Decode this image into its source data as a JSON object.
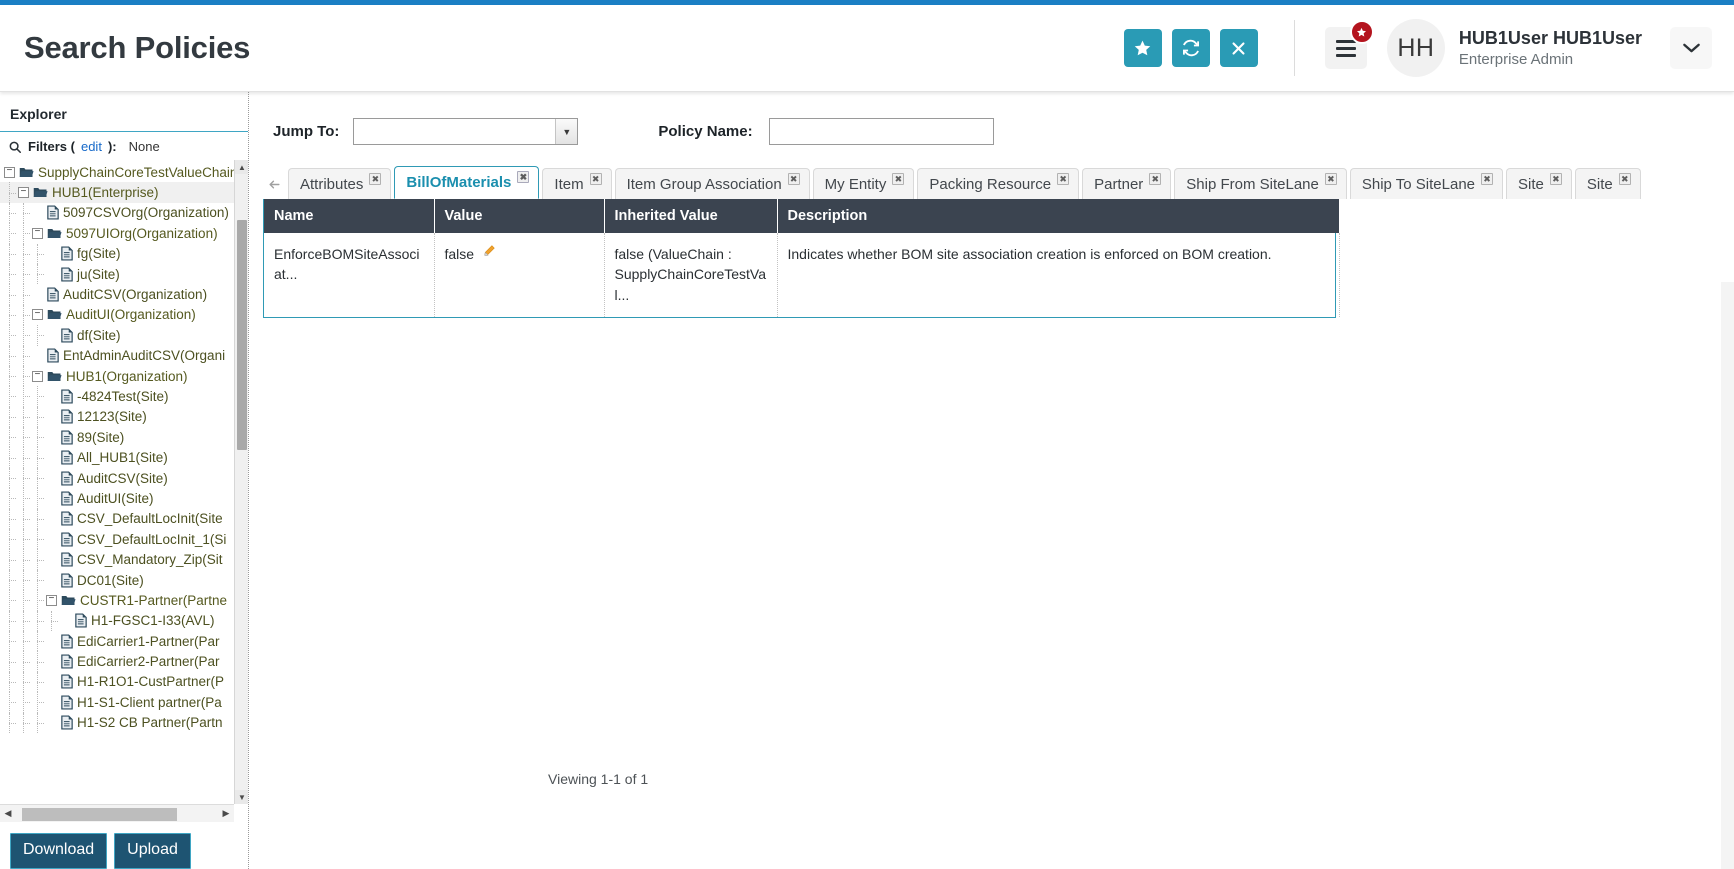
{
  "header": {
    "title": "Search Policies",
    "actions": [
      {
        "name": "favorite",
        "icon": "star-icon",
        "label": "★"
      },
      {
        "name": "refresh",
        "icon": "refresh-icon",
        "label": "⟳"
      },
      {
        "name": "close",
        "icon": "close-icon",
        "label": "✕"
      }
    ],
    "menu_badge": "★",
    "avatar_initials": "HH",
    "user_name": "HUB1User HUB1User",
    "user_role": "Enterprise Admin",
    "caret": "⌄"
  },
  "sidebar": {
    "title": "Explorer",
    "filters_label": "Filters (",
    "filters_edit": "edit",
    "filters_label_end": "):",
    "filters_value": "None",
    "footer_buttons": [
      {
        "label": "Download",
        "name": "download-button"
      },
      {
        "label": "Upload",
        "name": "upload-button"
      }
    ],
    "tree": [
      {
        "label": "SupplyChainCoreTestValueChain(",
        "depth": 0,
        "type": "folder",
        "toggle": "minus",
        "selected": false
      },
      {
        "label": "HUB1(Enterprise)",
        "depth": 1,
        "type": "folder",
        "toggle": "minus",
        "selected": true
      },
      {
        "label": "5097CSVOrg(Organization)",
        "depth": 2,
        "type": "file",
        "toggle": "none",
        "selected": false
      },
      {
        "label": "5097UIOrg(Organization)",
        "depth": 2,
        "type": "folder",
        "toggle": "minus",
        "selected": false
      },
      {
        "label": "fg(Site)",
        "depth": 3,
        "type": "file",
        "toggle": "none",
        "selected": false
      },
      {
        "label": "ju(Site)",
        "depth": 3,
        "type": "file",
        "toggle": "none",
        "selected": false
      },
      {
        "label": "AuditCSV(Organization)",
        "depth": 2,
        "type": "file",
        "toggle": "none",
        "selected": false
      },
      {
        "label": "AuditUI(Organization)",
        "depth": 2,
        "type": "folder",
        "toggle": "minus",
        "selected": false
      },
      {
        "label": "df(Site)",
        "depth": 3,
        "type": "file",
        "toggle": "none",
        "selected": false
      },
      {
        "label": "EntAdminAuditCSV(Organi",
        "depth": 2,
        "type": "file",
        "toggle": "none",
        "selected": false
      },
      {
        "label": "HUB1(Organization)",
        "depth": 2,
        "type": "folder",
        "toggle": "minus",
        "selected": false
      },
      {
        "label": "-4824Test(Site)",
        "depth": 3,
        "type": "file",
        "toggle": "none",
        "selected": false
      },
      {
        "label": "12123(Site)",
        "depth": 3,
        "type": "file",
        "toggle": "none",
        "selected": false
      },
      {
        "label": "89(Site)",
        "depth": 3,
        "type": "file",
        "toggle": "none",
        "selected": false
      },
      {
        "label": "All_HUB1(Site)",
        "depth": 3,
        "type": "file",
        "toggle": "none",
        "selected": false
      },
      {
        "label": "AuditCSV(Site)",
        "depth": 3,
        "type": "file",
        "toggle": "none",
        "selected": false
      },
      {
        "label": "AuditUI(Site)",
        "depth": 3,
        "type": "file",
        "toggle": "none",
        "selected": false
      },
      {
        "label": "CSV_DefaultLocInit(Site",
        "depth": 3,
        "type": "file",
        "toggle": "none",
        "selected": false
      },
      {
        "label": "CSV_DefaultLocInit_1(Si",
        "depth": 3,
        "type": "file",
        "toggle": "none",
        "selected": false
      },
      {
        "label": "CSV_Mandatory_Zip(Sit",
        "depth": 3,
        "type": "file",
        "toggle": "none",
        "selected": false
      },
      {
        "label": "DC01(Site)",
        "depth": 3,
        "type": "file",
        "toggle": "none",
        "selected": false
      },
      {
        "label": "CUSTR1-Partner(Partne",
        "depth": 3,
        "type": "folder",
        "toggle": "minus",
        "selected": false
      },
      {
        "label": "H1-FGSC1-I33(AVL)",
        "depth": 4,
        "type": "file",
        "toggle": "none",
        "selected": false
      },
      {
        "label": "EdiCarrier1-Partner(Par",
        "depth": 3,
        "type": "file",
        "toggle": "none",
        "selected": false
      },
      {
        "label": "EdiCarrier2-Partner(Par",
        "depth": 3,
        "type": "file",
        "toggle": "none",
        "selected": false
      },
      {
        "label": "H1-R1O1-CustPartner(P",
        "depth": 3,
        "type": "file",
        "toggle": "none",
        "selected": false
      },
      {
        "label": "H1-S1-Client partner(Pa",
        "depth": 3,
        "type": "file",
        "toggle": "none",
        "selected": false
      },
      {
        "label": "H1-S2 CB Partner(Partn",
        "depth": 3,
        "type": "file",
        "toggle": "none",
        "selected": false
      }
    ]
  },
  "main": {
    "jump_to_label": "Jump To:",
    "jump_to_value": "",
    "policy_name_label": "Policy Name:",
    "policy_name_value": "",
    "policy_name_placeholder": "",
    "tabs": [
      {
        "label": "Attributes",
        "active": false
      },
      {
        "label": "BillOfMaterials",
        "active": true
      },
      {
        "label": "Item",
        "active": false
      },
      {
        "label": "Item Group Association",
        "active": false
      },
      {
        "label": "My Entity",
        "active": false
      },
      {
        "label": "Packing Resource",
        "active": false
      },
      {
        "label": "Partner",
        "active": false
      },
      {
        "label": "Ship From SiteLane",
        "active": false
      },
      {
        "label": "Ship To SiteLane",
        "active": false
      },
      {
        "label": "Site",
        "active": false
      },
      {
        "label": "Site",
        "active": false
      }
    ],
    "table": {
      "columns": [
        "Name",
        "Value",
        "Inherited Value",
        "Description",
        ""
      ],
      "rows": [
        {
          "name": "EnforceBOMSiteAssociat...",
          "value": "false",
          "value_edit_icon": "✏",
          "inherited_line1": "false (ValueChain :",
          "inherited_line2": "SupplyChainCoreTestVal...",
          "description": "Indicates whether BOM site association creation is enforced on BOM creation."
        }
      ]
    },
    "viewing_text": "Viewing 1-1 of 1"
  },
  "colors": {
    "accent_blue": "#1b7fc4",
    "teal": "#2a9bb5",
    "tab_active": "#1b8fae",
    "table_header": "#3b4450",
    "button_navy": "#1e5472",
    "badge_red": "#b4141e"
  }
}
